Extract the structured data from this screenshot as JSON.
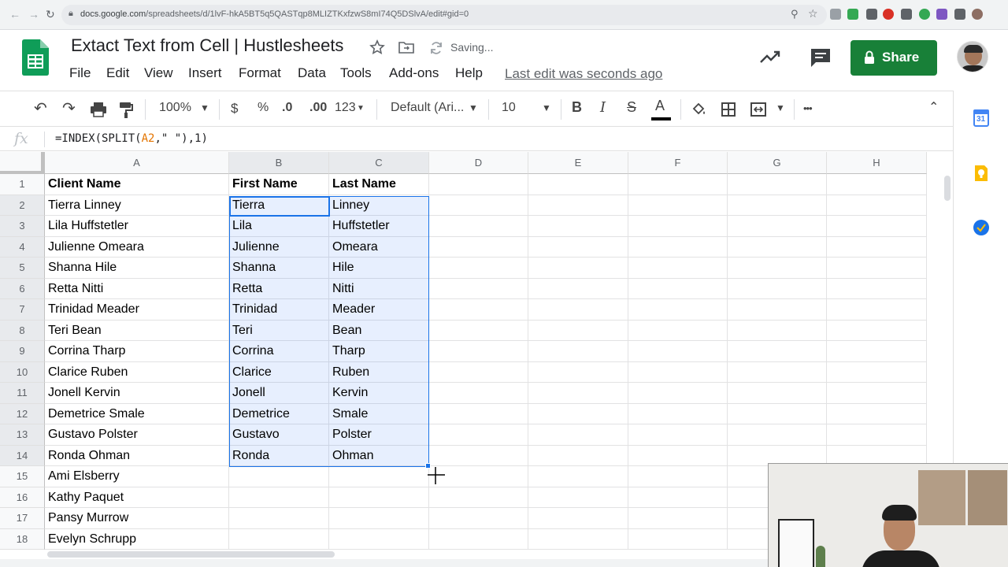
{
  "browser": {
    "url_host": "docs.google.com",
    "url_path": "/spreadsheets/d/1lvF-hkA5BT5q5QASTqp8MLIZTKxfzwS8mI74Q5DSlvA/edit#gid=0"
  },
  "header": {
    "title": "Extact Text from Cell | Hustlesheets",
    "status": "Saving...",
    "last_edit": "Last edit was seconds ago",
    "share_label": "Share",
    "menu": [
      "File",
      "Edit",
      "View",
      "Insert",
      "Format",
      "Data",
      "Tools",
      "Add-ons",
      "Help"
    ]
  },
  "toolbar": {
    "zoom": "100%",
    "currency": "$",
    "percent": "%",
    "decrease_decimal": ".0",
    "increase_decimal": ".00",
    "more_formats": "123",
    "font": "Default (Ari...",
    "font_size": "10",
    "bold": "B",
    "italic": "I",
    "strike": "S",
    "text_color": "A",
    "more": "•••"
  },
  "formula_bar": {
    "fx": "fx",
    "formula_start": "=INDEX(SPLIT(",
    "formula_ref": "A2",
    "formula_end": ",\" \"),1)"
  },
  "sheet": {
    "columns": [
      "A",
      "B",
      "C",
      "D",
      "E",
      "F",
      "G",
      "H"
    ],
    "row_numbers": [
      "1",
      "2",
      "3",
      "4",
      "5",
      "6",
      "7",
      "8",
      "9",
      "10",
      "11",
      "12",
      "13",
      "14",
      "15",
      "16",
      "17",
      "18"
    ],
    "header_row": [
      "Client Name",
      "First Name",
      "Last Name"
    ],
    "client_names": [
      "Tierra Linney",
      "Lila Huffstetler",
      "Julienne Omeara",
      "Shanna Hile",
      "Retta Nitti",
      "Trinidad Meader",
      "Teri Bean",
      "Corrina Tharp",
      "Clarice Ruben",
      "Jonell Kervin",
      "Demetrice Smale",
      "Gustavo Polster",
      "Ronda Ohman",
      "Ami Elsberry",
      "Kathy Paquet",
      "Pansy Murrow",
      "Evelyn Schrupp"
    ],
    "first_names": [
      "Tierra",
      "Lila",
      "Julienne",
      "Shanna",
      "Retta",
      "Trinidad",
      "Teri",
      "Corrina",
      "Clarice",
      "Jonell",
      "Demetrice",
      "Gustavo",
      "Ronda"
    ],
    "last_names": [
      "Linney",
      "Huffstetler",
      "Omeara",
      "Hile",
      "Nitti",
      "Meader",
      "Bean",
      "Tharp",
      "Ruben",
      "Kervin",
      "Smale",
      "Polster",
      "Ohman"
    ]
  },
  "side_panel": {
    "calendar_day": "31"
  },
  "colors": {
    "share_green": "#188038",
    "selection_blue": "#1a73e8",
    "sheets_green": "#0f9d58"
  }
}
